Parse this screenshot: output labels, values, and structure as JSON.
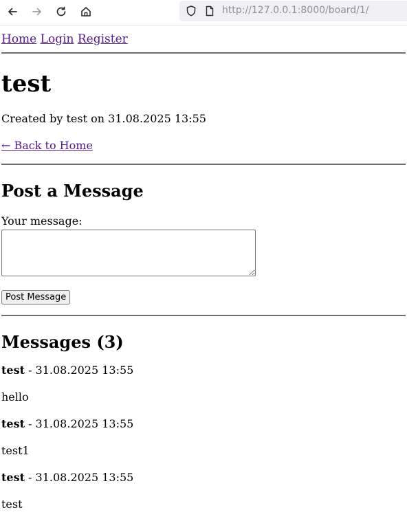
{
  "browser": {
    "url_scheme": "http://",
    "url_host": "127.0.0.1",
    "url_rest": ":8000/board/1/"
  },
  "nav": {
    "home": "Home",
    "login": "Login",
    "register": "Register"
  },
  "board": {
    "title": "test",
    "created_info": "Created by test on 31.08.2025 13:55",
    "back_link": "← Back to Home"
  },
  "post_form": {
    "heading": "Post a Message",
    "label": "Your message:",
    "value": "",
    "submit_label": "Post Message"
  },
  "messages": {
    "heading": "Messages (3)",
    "items": [
      {
        "author": "test",
        "meta": " - 31.08.2025 13:55",
        "text": "hello"
      },
      {
        "author": "test",
        "meta": " - 31.08.2025 13:55",
        "text": "test1"
      },
      {
        "author": "test",
        "meta": " - 31.08.2025 13:55",
        "text": "test"
      }
    ]
  }
}
